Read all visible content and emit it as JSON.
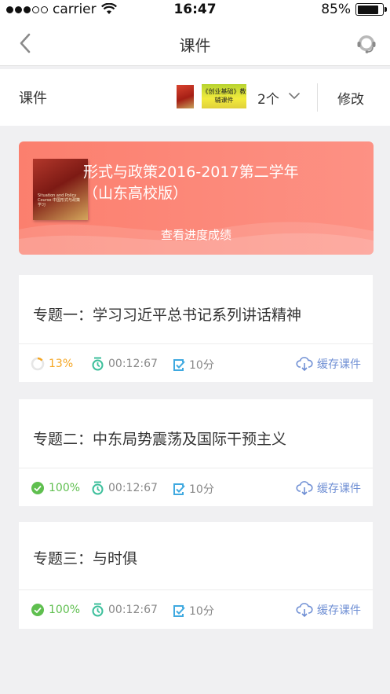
{
  "status_bar": {
    "carrier": "carrier",
    "time": "16:47",
    "battery_text": "85%",
    "battery_level": 0.85
  },
  "nav": {
    "title": "课件"
  },
  "selector": {
    "label": "课件",
    "thumb2_text": "《创业基础》教辅课件",
    "count": "2个",
    "edit": "修改"
  },
  "banner": {
    "title_line1": "形式与政策2016-2017第二学年",
    "title_line2": "（山东高校版）",
    "link": "查看进度成绩",
    "cover_text": "Situation and Policy Course 中国形式与政策学习"
  },
  "topics": [
    {
      "title": "专题一：学习习近平总书记系列讲话精神",
      "progress": "13%",
      "progress_value": 0.13,
      "duration": "00:12:67",
      "score": "10分",
      "cache": "缓存课件"
    },
    {
      "title": "专题二：中东局势震荡及国际干预主义",
      "progress": "100%",
      "progress_value": 1.0,
      "duration": "00:12:67",
      "score": "10分",
      "cache": "缓存课件"
    },
    {
      "title": "专题三：与时俱",
      "progress": "100%",
      "progress_value": 1.0,
      "duration": "00:12:67",
      "score": "10分",
      "cache": "缓存课件"
    }
  ],
  "colors": {
    "banner": "#fb7f6e",
    "progress_partial": "#f5a623",
    "progress_done": "#5fbf4f",
    "timer_icon": "#3cbf9b",
    "score_icon": "#3fa9e0",
    "cache_link": "#6f8fd4"
  }
}
